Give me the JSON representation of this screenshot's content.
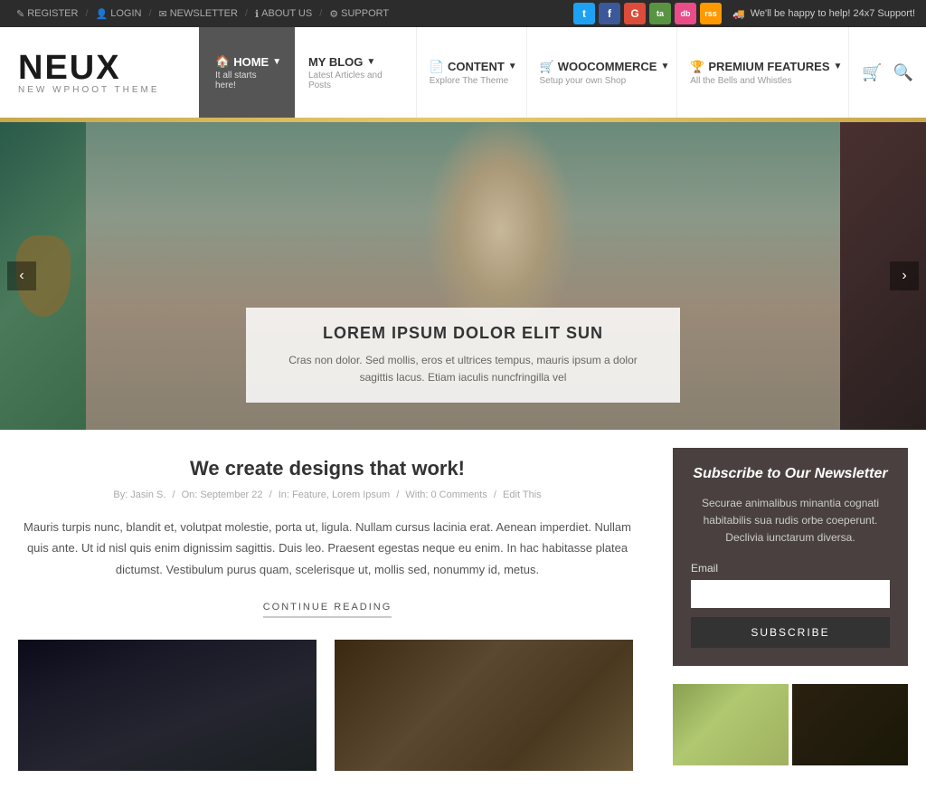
{
  "topbar": {
    "links": [
      {
        "label": "REGISTER",
        "icon": "✎"
      },
      {
        "label": "LOGIN",
        "icon": "👤"
      },
      {
        "label": "NEWSLETTER",
        "icon": "✉"
      },
      {
        "label": "ABOUT US",
        "icon": "ℹ"
      },
      {
        "label": "SUPPORT",
        "icon": "⚙"
      }
    ],
    "social": [
      {
        "name": "twitter",
        "label": "t",
        "class": "si-twitter"
      },
      {
        "name": "facebook",
        "label": "f",
        "class": "si-facebook"
      },
      {
        "name": "google",
        "label": "G",
        "class": "si-google"
      },
      {
        "name": "tripadvisor",
        "label": "ta",
        "class": "si-tripadvisor"
      },
      {
        "name": "dribbble",
        "label": "db",
        "class": "si-dribbble"
      },
      {
        "name": "rss",
        "label": "rss",
        "class": "si-rss"
      }
    ],
    "support_text": "We'll be happy to help! 24x7 Support!"
  },
  "header": {
    "logo_title": "NEUX",
    "logo_subtitle": "NEW WPHOOT THEME",
    "nav": [
      {
        "label": "HOME",
        "sub": "It all starts here!",
        "icon": "🏠",
        "has_arrow": true
      },
      {
        "label": "MY BLOG",
        "sub": "Latest Articles and Posts",
        "icon": "",
        "has_arrow": true
      },
      {
        "label": "CONTENT",
        "sub": "Explore The Theme",
        "icon": "📄",
        "has_arrow": true
      },
      {
        "label": "WOOCOMMERCE",
        "sub": "Setup your own Shop",
        "icon": "🛒",
        "has_arrow": true
      },
      {
        "label": "PREMIUM FEATURES",
        "sub": "All the Bells and Whistles",
        "icon": "🏆",
        "has_arrow": true
      }
    ]
  },
  "slider": {
    "title": "LOREM IPSUM DOLOR ELIT SUN",
    "description": "Cras non dolor. Sed mollis, eros et ultrices tempus, mauris ipsum a dolor sagittis lacus. Etiam iaculis nuncfringilla vel"
  },
  "article": {
    "title": "We create designs that work!",
    "meta_author": "By: Jasin S.",
    "meta_date": "On: September 22",
    "meta_category": "In: Feature, Lorem Ipsum",
    "meta_comments": "With: 0 Comments",
    "meta_edit": "Edit This",
    "body": "Mauris turpis nunc, blandit et, volutpat molestie, porta ut, ligula. Nullam cursus lacinia erat. Aenean imperdiet. Nullam quis ante. Ut id nisl quis enim dignissim sagittis. Duis leo. Praesent egestas neque eu enim. In hac habitasse platea dictumst. Vestibulum purus quam, scelerisque ut, mollis sed, nonummy id, metus.",
    "continue_label": "CONTINUE READING"
  },
  "sidebar": {
    "newsletter_title": "Subscribe to Our Newsletter",
    "newsletter_desc": "Securae animalibus minantia cognati habitabilis sua rudis orbe coeperunt. Declivia iunctarum diversa.",
    "email_label": "Email",
    "email_placeholder": "",
    "subscribe_label": "SUBSCRIBE"
  }
}
